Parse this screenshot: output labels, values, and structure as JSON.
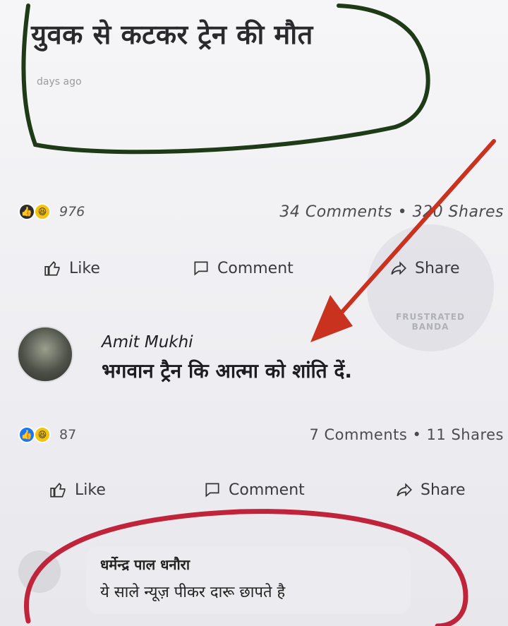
{
  "post": {
    "headline": "युवक से कटकर ट्रेन की मौत",
    "time_ago": "days ago",
    "reaction_count": "976",
    "comments_shares": "34 Comments • 320 Shares"
  },
  "actions_top": {
    "like": "Like",
    "comment": "Comment",
    "share": "Share"
  },
  "watermark": {
    "line1": "FRUSTRATED",
    "line2": "BANDA"
  },
  "comment": {
    "author": "Amit Mukhi",
    "text": "भगवान ट्रैन कि आत्मा को शांति दें.",
    "reaction_count": "87",
    "comments_shares": "7 Comments • 11 Shares"
  },
  "actions_bottom": {
    "like": "Like",
    "comment": "Comment",
    "share": "Share"
  },
  "reply": {
    "author": "धर्मेन्द्र पाल धनौरा",
    "text": "ये साले न्यूज़ पीकर दारू छापते है"
  },
  "colors": {
    "annotation_green": "#1f3a17",
    "arrow_red": "#c8321e",
    "circle_red": "#c0243a"
  }
}
